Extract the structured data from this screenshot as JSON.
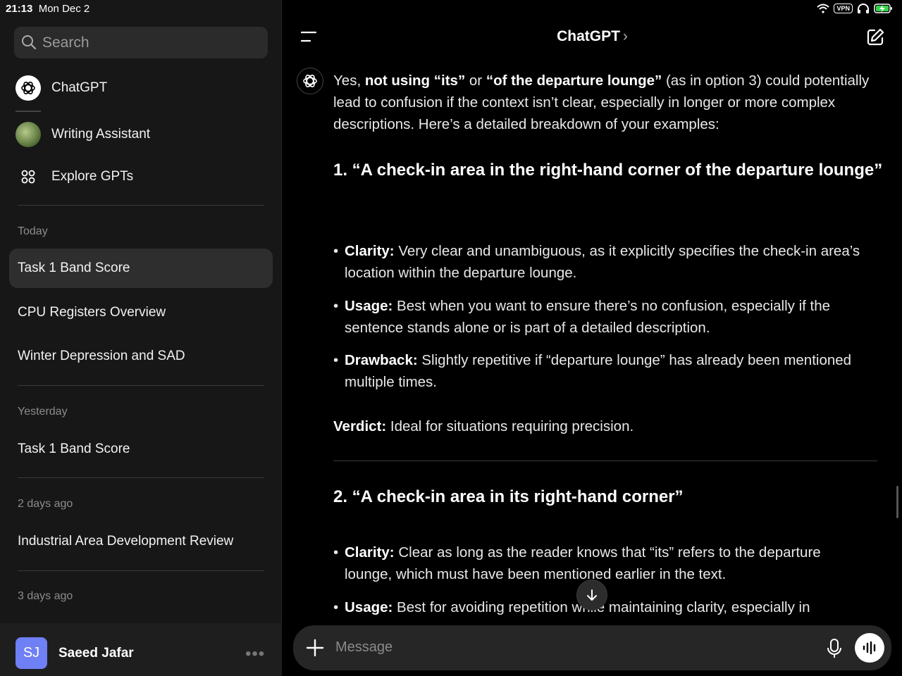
{
  "status_bar": {
    "time": "21:13",
    "date": "Mon Dec 2",
    "vpn": "VPN"
  },
  "sidebar": {
    "search_placeholder": "Search",
    "nav": [
      {
        "label": "ChatGPT",
        "icon": "openai-logo-icon"
      },
      {
        "label": "Writing Assistant",
        "icon": "writing-assistant-avatar"
      },
      {
        "label": "Explore GPTs",
        "icon": "grid-icon"
      }
    ],
    "sections": [
      {
        "label": "Today",
        "items": [
          "Task 1 Band Score",
          "CPU Registers Overview",
          "Winter Depression and SAD"
        ]
      },
      {
        "label": "Yesterday",
        "items": [
          "Task 1 Band Score"
        ]
      },
      {
        "label": "2 days ago",
        "items": [
          "Industrial Area Development Review"
        ]
      },
      {
        "label": "3 days ago",
        "items": []
      }
    ],
    "active_chat": "Task 1 Band Score",
    "user": {
      "initials": "SJ",
      "name": "Saeed Jafar",
      "more": "•••"
    }
  },
  "main": {
    "title": "ChatGPT",
    "title_chevron": "›",
    "message": {
      "intro_1": "Yes, ",
      "intro_bold_1": "not using “its”",
      "intro_2": " or ",
      "intro_bold_2": "“of the departure lounge”",
      "intro_3": " (as in option 3) could potentially lead to confusion if the context isn’t clear, especially in longer or more complex descriptions. Here’s a detailed breakdown of your examples:",
      "option1": {
        "heading": "1. “A check-in area in the right-hand corner of the departure lounge”",
        "bullets": [
          {
            "label": "Clarity:",
            "text": " Very clear and unambiguous, as it explicitly specifies the check-in area’s location within the departure lounge."
          },
          {
            "label": "Usage:",
            "text": " Best when you want to ensure there’s no confusion, especially if the sentence stands alone or is part of a detailed description."
          },
          {
            "label": "Drawback:",
            "text": " Slightly repetitive if “departure lounge” has already been mentioned multiple times."
          }
        ],
        "verdict_label": "Verdict:",
        "verdict_text": " Ideal for situations requiring precision."
      },
      "option2": {
        "heading": "2. “A check-in area in its right-hand corner”",
        "bullets": [
          {
            "label": "Clarity:",
            "text": " Clear as long as the reader knows that “its” refers to the departure lounge, which must have been mentioned earlier in the text."
          },
          {
            "label": "Usage:",
            "text": " Best for avoiding repetition while maintaining clarity, especially in"
          }
        ]
      }
    },
    "composer": {
      "placeholder": "Message"
    }
  }
}
